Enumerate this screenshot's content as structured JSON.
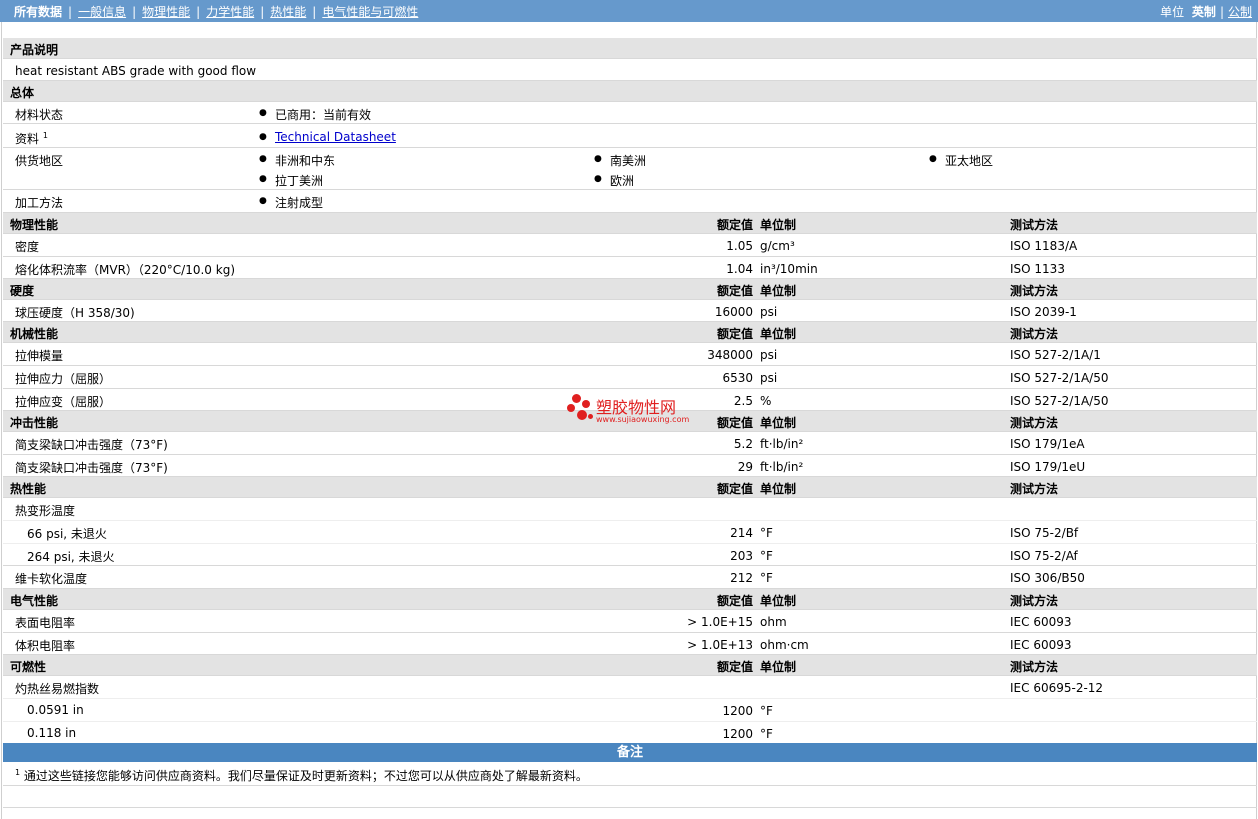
{
  "nav": {
    "items": [
      "所有数据",
      "一般信息",
      "物理性能",
      "力学性能",
      "热性能",
      "电气性能与可燃性"
    ],
    "units_label": "单位",
    "unit_active": "英制",
    "unit_other": "公制"
  },
  "colors": {
    "header_bar": "#6699cc",
    "section_bg": "#e3e3e3",
    "note_bar": "#4a86c0",
    "watermark": "#e02020"
  },
  "description": {
    "title": "产品说明",
    "text": "heat resistant ABS grade with good flow"
  },
  "general": {
    "title": "总体",
    "status_label": "材料状态",
    "status_value": "已商用：当前有效",
    "docs_label": "资料",
    "docs_sup": "1",
    "docs_link": "Technical Datasheet",
    "regions_label": "供货地区",
    "regions": [
      "非洲和中东",
      "南美洲",
      "亚太地区",
      "拉丁美洲",
      "欧洲"
    ],
    "process_label": "加工方法",
    "process_value": "注射成型"
  },
  "headers": {
    "value": "额定值",
    "unit": "单位制",
    "method": "测试方法"
  },
  "sections": {
    "physical": {
      "title": "物理性能",
      "rows": [
        {
          "label": "密度",
          "value": "1.05",
          "unit": "g/cm³",
          "method": "ISO 1183/A"
        },
        {
          "label": "熔化体积流率（MVR）（220°C/10.0 kg)",
          "value": "1.04",
          "unit": "in³/10min",
          "method": "ISO 1133"
        }
      ]
    },
    "hardness": {
      "title": "硬度",
      "rows": [
        {
          "label": "球压硬度（H 358/30)",
          "value": "16000",
          "unit": "psi",
          "method": "ISO 2039-1"
        }
      ]
    },
    "mechanical": {
      "title": "机械性能",
      "rows": [
        {
          "label": "拉伸模量",
          "value": "348000",
          "unit": "psi",
          "method": "ISO 527-2/1A/1"
        },
        {
          "label": "拉伸应力（屈服）",
          "value": "6530",
          "unit": "psi",
          "method": "ISO 527-2/1A/50"
        },
        {
          "label": "拉伸应变（屈服）",
          "value": "2.5",
          "unit": "%",
          "method": "ISO 527-2/1A/50"
        }
      ]
    },
    "impact": {
      "title": "冲击性能",
      "rows": [
        {
          "label": "简支梁缺口冲击强度（73°F)",
          "value": "5.2",
          "unit": "ft·lb/in²",
          "method": "ISO 179/1eA"
        },
        {
          "label": "简支梁缺口冲击强度（73°F)",
          "value": "29",
          "unit": "ft·lb/in²",
          "method": "ISO 179/1eU"
        }
      ]
    },
    "thermal": {
      "title": "热性能",
      "hdt_label": "热变形温度",
      "rows": [
        {
          "label": "66 psi, 未退火",
          "value": "214",
          "unit": "°F",
          "method": "ISO 75-2/Bf"
        },
        {
          "label": "264 psi, 未退火",
          "value": "203",
          "unit": "°F",
          "method": "ISO 75-2/Af"
        },
        {
          "label": "维卡软化温度",
          "value": "212",
          "unit": "°F",
          "method": "ISO 306/B50"
        }
      ]
    },
    "electrical": {
      "title": "电气性能",
      "rows": [
        {
          "label": "表面电阻率",
          "value": "> 1.0E+15",
          "unit": "ohm",
          "method": "IEC 60093"
        },
        {
          "label": "体积电阻率",
          "value": "> 1.0E+13",
          "unit": "ohm·cm",
          "method": "IEC 60093"
        }
      ]
    },
    "flammability": {
      "title": "可燃性",
      "gwfi_label": "灼热丝易燃指数",
      "gwfi_method": "IEC 60695-2-12",
      "rows": [
        {
          "label": "0.0591 in",
          "value": "1200",
          "unit": "°F"
        },
        {
          "label": "0.118 in",
          "value": "1200",
          "unit": "°F"
        }
      ]
    }
  },
  "notes": {
    "title": "备注",
    "footnote_num": "1",
    "footnote_text": "通过这些链接您能够访问供应商资料。我们尽量保证及时更新资料；不过您可以从供应商处了解最新资料。"
  },
  "watermark": {
    "main": "塑胶物性网",
    "url": "www.sujiaowuxing.com"
  }
}
